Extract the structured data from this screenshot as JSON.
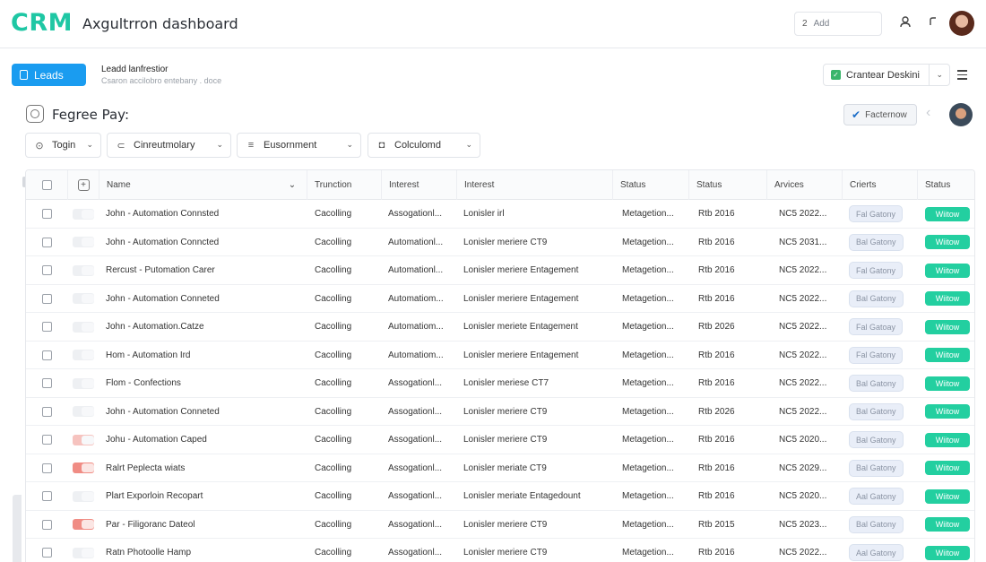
{
  "header": {
    "logo": "CRM",
    "title": "Axgultrron dashboard",
    "add_number": "2",
    "add_label": "Add"
  },
  "subbar": {
    "lead_button": "Leads",
    "lead_title": "Leadd lanfrestior",
    "lead_subtitle": "Csaron accilobro entebany . doce",
    "desk_button": "Crantear Deskini"
  },
  "page": {
    "title": "Fegree Pay:",
    "factor_button": "Facternow"
  },
  "filters": [
    {
      "label": "Togin",
      "icon": "toggle-icon"
    },
    {
      "label": "Cinreutmolary",
      "icon": "link-icon"
    },
    {
      "label": "Eusornment",
      "icon": "list-icon"
    },
    {
      "label": "Colculomd",
      "icon": "camera-icon"
    }
  ],
  "table": {
    "columns": [
      "Name",
      "Trunction",
      "Interest",
      "Interest",
      "Status",
      "Status",
      "Arvices",
      "Crierts",
      "Status"
    ],
    "rows": [
      {
        "toggle": "off",
        "name": "John - Automation Connsted",
        "trunction": "Cacolling",
        "interest1": "Assogationl...",
        "interest2": "Lonisler irl",
        "status1": "Metagetion...",
        "status2": "Rtb 2016",
        "arvices": "NC5 2022...",
        "crierts": "Fal Gatony",
        "status3": "Wiitow"
      },
      {
        "toggle": "off",
        "name": "John - Automation Conncted",
        "trunction": "Cacolling",
        "interest1": "Automationl...",
        "interest2": "Lonisler meriere CT9",
        "status1": "Metagetion...",
        "status2": "Rtb 2016",
        "arvices": "NC5 2031...",
        "crierts": "Bal Gatony",
        "status3": "Wiitow"
      },
      {
        "toggle": "off",
        "name": "Rercust - Putomation Carer",
        "trunction": "Cacolling",
        "interest1": "Automationl...",
        "interest2": "Lonisler meriere Entagement",
        "status1": "Metagetion...",
        "status2": "Rtb 2016",
        "arvices": "NC5 2022...",
        "crierts": "Fal Gatony",
        "status3": "Wiitow"
      },
      {
        "toggle": "off",
        "name": "John - Automation Conneted",
        "trunction": "Cacolling",
        "interest1": "Automatiom...",
        "interest2": "Lonisler meriere Entagement",
        "status1": "Metagetion...",
        "status2": "Rtb 2016",
        "arvices": "NC5 2022...",
        "crierts": "Bal Gatony",
        "status3": "Wiitow"
      },
      {
        "toggle": "off",
        "name": "John - Automation.Catze",
        "trunction": "Cacolling",
        "interest1": "Automatiom...",
        "interest2": "Lonisler meriete Entagement",
        "status1": "Metagetion...",
        "status2": "Rtb 2026",
        "arvices": "NC5 2022...",
        "crierts": "Fal Gatoay",
        "status3": "Wiitow"
      },
      {
        "toggle": "off",
        "name": "Hom - Automation Ird",
        "trunction": "Cacolling",
        "interest1": "Automatiom...",
        "interest2": "Lonisler meriere Entagement",
        "status1": "Metagetion...",
        "status2": "Rtb 2016",
        "arvices": "NC5 2022...",
        "crierts": "Fal Gatony",
        "status3": "Wiitow"
      },
      {
        "toggle": "off",
        "name": "Flom - Confections",
        "trunction": "Cacolling",
        "interest1": "Assogationl...",
        "interest2": "Lonisler meriese CT7",
        "status1": "Metagetion...",
        "status2": "Rtb 2016",
        "arvices": "NC5 2022...",
        "crierts": "Bal Gatony",
        "status3": "Wiitow"
      },
      {
        "toggle": "off",
        "name": "John - Automation Conneted",
        "trunction": "Cacolling",
        "interest1": "Assogationl...",
        "interest2": "Lonisler meriere CT9",
        "status1": "Metagetion...",
        "status2": "Rtb 2026",
        "arvices": "NC5 2022...",
        "crierts": "Bal Gatony",
        "status3": "Wiitow"
      },
      {
        "toggle": "on",
        "name": "Johu - Automation Caped",
        "trunction": "Cacolling",
        "interest1": "Assogationl...",
        "interest2": "Lonisler meriere CT9",
        "status1": "Metagetion...",
        "status2": "Rtb 2016",
        "arvices": "NC5 2020...",
        "crierts": "Bal Gatony",
        "status3": "Wiitow"
      },
      {
        "toggle": "red",
        "name": "Ralrt Peplecta wiats",
        "trunction": "Cacolling",
        "interest1": "Assogationl...",
        "interest2": "Lonisler meriate CT9",
        "status1": "Metagetion...",
        "status2": "Rtb 2016",
        "arvices": "NC5 2029...",
        "crierts": "Bal Gatony",
        "status3": "Wiitow"
      },
      {
        "toggle": "off",
        "name": "Plart Exporloin Recopart",
        "trunction": "Cacolling",
        "interest1": "Assogationl...",
        "interest2": "Lonisler meriate Entagedount",
        "status1": "Metagetion...",
        "status2": "Rtb 2016",
        "arvices": "NC5 2020...",
        "crierts": "Aal Gatony",
        "status3": "Wiitow"
      },
      {
        "toggle": "red",
        "name": "Par - Filigoranc Dateol",
        "trunction": "Cacolling",
        "interest1": "Assogationl...",
        "interest2": "Lonisler meriere CT9",
        "status1": "Metagetion...",
        "status2": "Rtb 2015",
        "arvices": "NC5 2023...",
        "crierts": "Bal Gatony",
        "status3": "Wiitow"
      },
      {
        "toggle": "off",
        "name": "Ratn Photoolle Hamp",
        "trunction": "Cacolling",
        "interest1": "Assogationl...",
        "interest2": "Lonisler meriere CT9",
        "status1": "Metagetion...",
        "status2": "Rtb 2016",
        "arvices": "NC5 2022...",
        "crierts": "Aal Gatony",
        "status3": "Wiitow"
      }
    ]
  }
}
